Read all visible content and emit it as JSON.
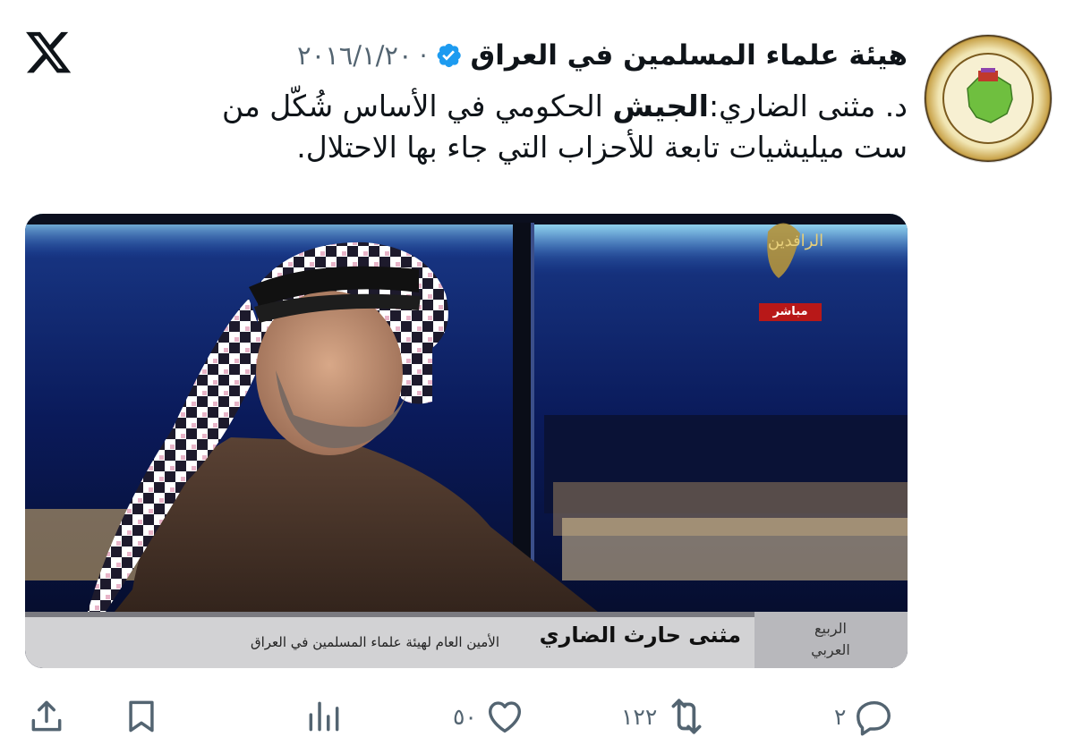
{
  "header": {
    "display_name": "هيئة علماء المسلمين في العراق",
    "dot": "·",
    "date": "٢٠١٦/١/٢٠"
  },
  "tweet": {
    "text_prefix": "د. مثنى الضاري:",
    "text_bold": "الجيش",
    "text_line1_rest": " الحكومي في الأساس شُكّل من",
    "text_line2": "ست ميليشيات تابعة للأحزاب التي جاء بها الاحتلال."
  },
  "media": {
    "channel_logo": "الرافدين",
    "live_badge": "مباشر",
    "lower_third_name": "مثنى حارث الضاري",
    "lower_third_title": "الأمين العام لهيئة علماء المسلمين في العراق",
    "program_label_line1": "الربيع",
    "program_label_line2": "العربي"
  },
  "actions": {
    "replies": "٢",
    "reposts": "١٢٢",
    "likes": "٥٠",
    "icons": [
      "reply-icon",
      "repost-icon",
      "like-icon",
      "views-icon",
      "bookmark-icon",
      "share-icon"
    ]
  },
  "colors": {
    "verified": "#1d9bf0",
    "muted": "#536471",
    "text": "#0f1419"
  }
}
